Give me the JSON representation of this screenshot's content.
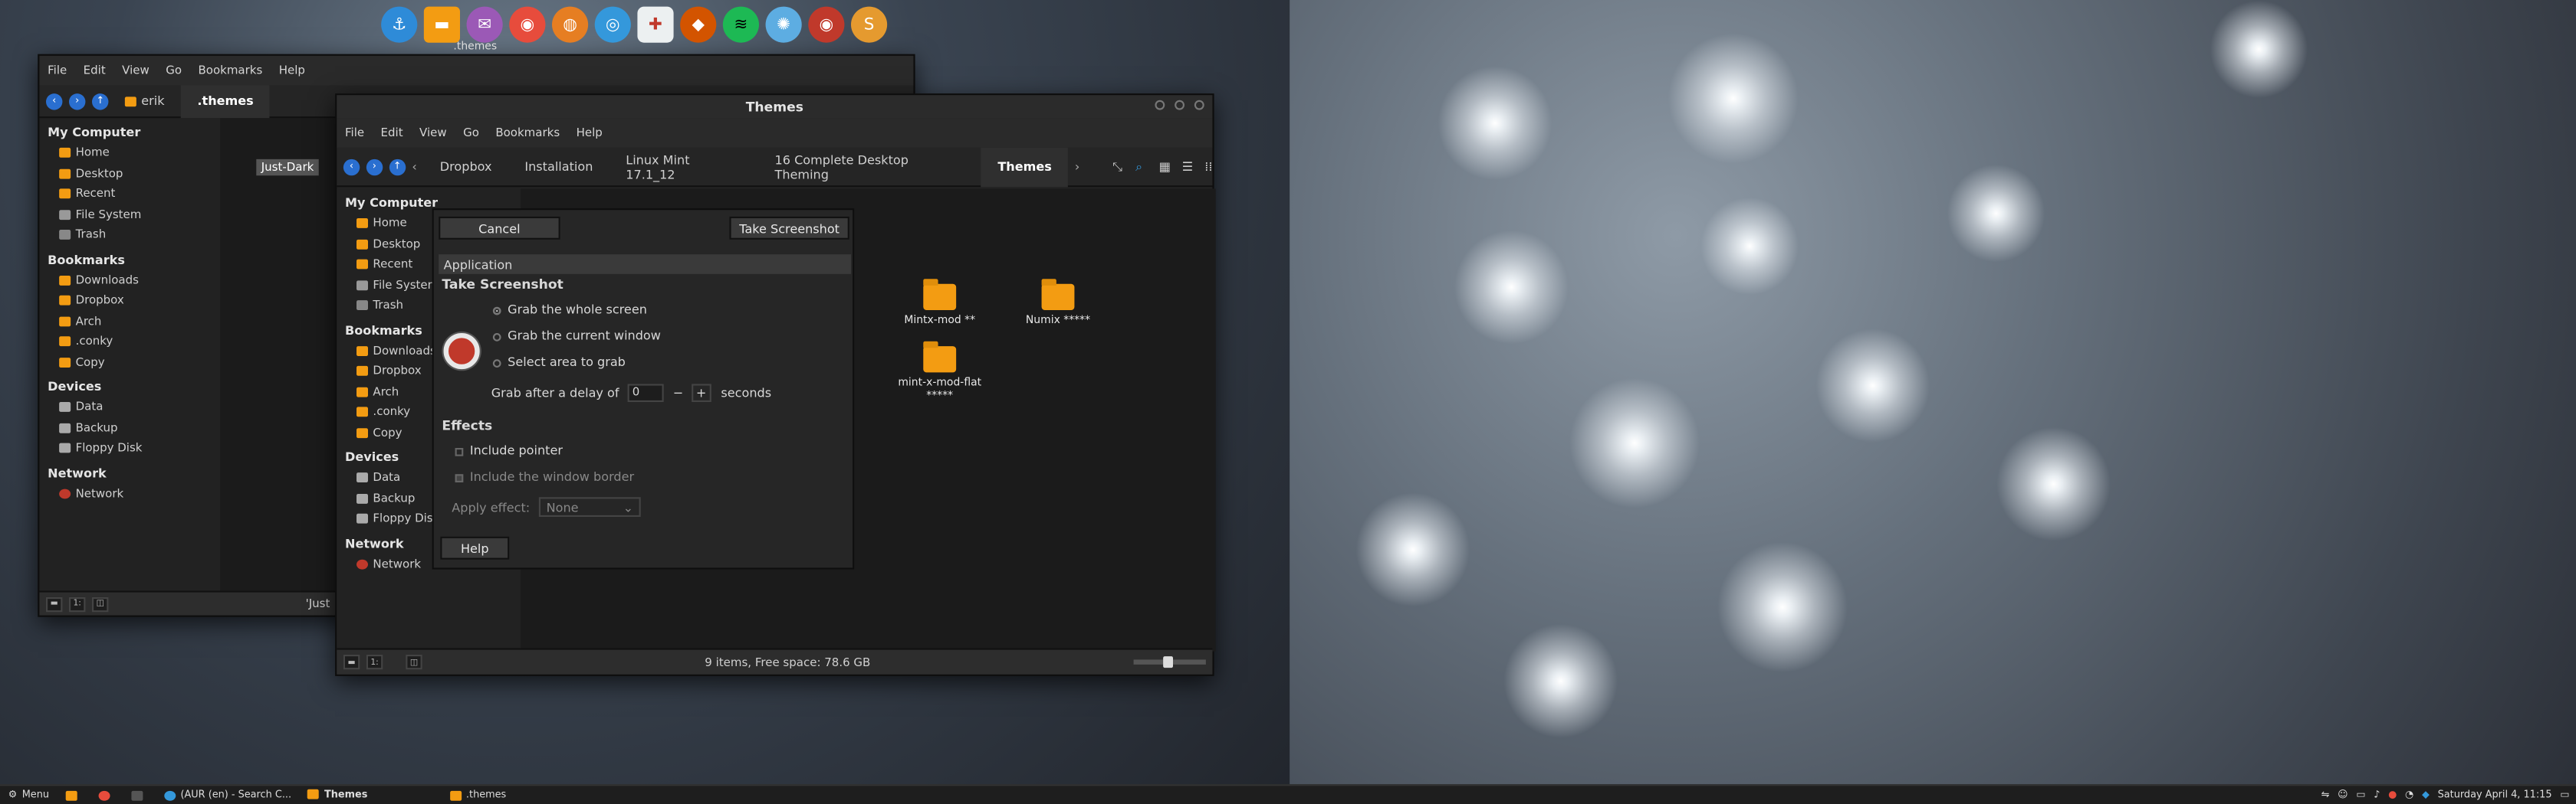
{
  "dock": {
    "label": ".themes",
    "apps": [
      {
        "icon": "anchor-icon",
        "glyph": "⚓",
        "color": "#2e8bd8"
      },
      {
        "icon": "folder-icon",
        "glyph": "▬",
        "color": "#f39c12"
      },
      {
        "icon": "mail-icon",
        "glyph": "✉",
        "color": "#9b59b6"
      },
      {
        "icon": "chrome-icon",
        "glyph": "◉",
        "color": "#e74c3c"
      },
      {
        "icon": "firefox-icon",
        "glyph": "◍",
        "color": "#e67e22"
      },
      {
        "icon": "chromium-icon",
        "glyph": "◎",
        "color": "#3498db"
      },
      {
        "icon": "slack-icon",
        "glyph": "✚",
        "color": "#ecf0f1"
      },
      {
        "icon": "cutter-icon",
        "glyph": "◆",
        "color": "#d35400"
      },
      {
        "icon": "spotify-icon",
        "glyph": "≋",
        "color": "#1db954"
      },
      {
        "icon": "shutter-icon",
        "glyph": "✺",
        "color": "#5dade2"
      },
      {
        "icon": "screenshot-icon",
        "glyph": "◉",
        "color": "#c0392b"
      },
      {
        "icon": "sublime-icon",
        "glyph": "S",
        "color": "#e59a2f"
      }
    ]
  },
  "back_window": {
    "menu": [
      "File",
      "Edit",
      "View",
      "Go",
      "Bookmarks",
      "Help"
    ],
    "crumbs": [
      "erik",
      ".themes"
    ],
    "sidebar": {
      "my_computer": "My Computer",
      "places": [
        "Home",
        "Desktop",
        "Recent",
        "File System",
        "Trash"
      ],
      "bookmarks": "Bookmarks",
      "bookmark_items": [
        "Downloads",
        "Dropbox",
        "Arch",
        ".conky",
        "Copy"
      ],
      "devices": "Devices",
      "device_items": [
        "Data",
        "Backup",
        "Floppy Disk"
      ],
      "network": "Network",
      "network_items": [
        "Network"
      ]
    },
    "selected_item": "Just-Dark",
    "status_partial": "'Just"
  },
  "themes_window": {
    "title": "Themes",
    "menu": [
      "File",
      "Edit",
      "View",
      "Go",
      "Bookmarks",
      "Help"
    ],
    "crumbs": [
      "Dropbox",
      "Installation",
      "Linux Mint 17.1_12",
      "16 Complete Desktop Theming",
      "Themes"
    ],
    "sidebar": {
      "my_computer": "My Computer",
      "places": [
        "Home",
        "Desktop",
        "Recent",
        "File System",
        "Trash"
      ],
      "bookmarks": "Bookmarks",
      "bookmark_items": [
        "Downloads",
        "Dropbox",
        "Arch",
        ".conky",
        "Copy"
      ],
      "devices": "Devices",
      "device_items": [
        "Data",
        "Backup",
        "Floppy Disk"
      ],
      "network": "Network",
      "network_items": [
        "Network"
      ]
    },
    "folders": [
      {
        "name": "Mintx-mod **"
      },
      {
        "name": "Numix *****"
      },
      {
        "name": "mint-x-mod-flat *****"
      }
    ],
    "status": "9 items, Free space: 78.6 GB"
  },
  "screenshot_dialog": {
    "cancel": "Cancel",
    "take": "Take Screenshot",
    "tab": "Application",
    "section_title": "Take Screenshot",
    "options": [
      "Grab the whole screen",
      "Grab the current window",
      "Select area to grab"
    ],
    "delay_label": "Grab after a delay of",
    "delay_value": "0",
    "minus": "−",
    "plus": "+",
    "delay_unit": "seconds",
    "effects_title": "Effects",
    "include_pointer": "Include pointer",
    "include_border": "Include the window border",
    "apply_effect_label": "Apply effect:",
    "apply_effect_value": "None",
    "help": "Help"
  },
  "taskbar": {
    "menu": "Menu",
    "items": [
      "(AUR (en) - Search C...",
      "Themes",
      ".themes"
    ],
    "clock": "Saturday April 4, 11:15"
  }
}
